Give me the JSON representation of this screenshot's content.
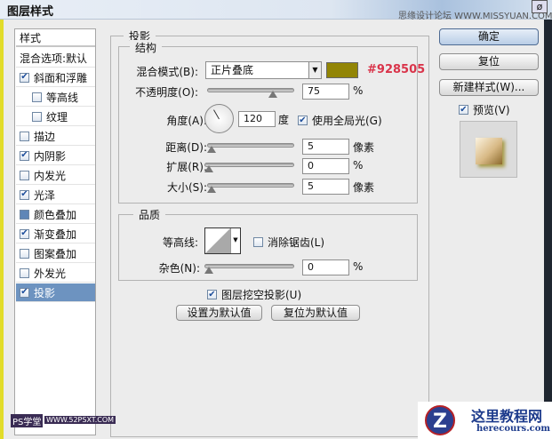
{
  "window": {
    "title": "图层样式",
    "close_label": "ø",
    "watermark": "思缘设计论坛 WWW.MISSYUAN.COM"
  },
  "styles": {
    "header": "样式",
    "blend_default": "混合选项:默认",
    "items": [
      {
        "label": "斜面和浮雕",
        "checked": true,
        "indent": false
      },
      {
        "label": "等高线",
        "checked": false,
        "indent": true
      },
      {
        "label": "纹理",
        "checked": false,
        "indent": true
      },
      {
        "label": "描边",
        "checked": false,
        "indent": false
      },
      {
        "label": "内阴影",
        "checked": true,
        "indent": false
      },
      {
        "label": "内发光",
        "checked": false,
        "indent": false
      },
      {
        "label": "光泽",
        "checked": true,
        "indent": false
      },
      {
        "label": "颜色叠加",
        "checked": false,
        "indent": false,
        "filled": true
      },
      {
        "label": "渐变叠加",
        "checked": true,
        "indent": false
      },
      {
        "label": "图案叠加",
        "checked": false,
        "indent": false
      },
      {
        "label": "外发光",
        "checked": false,
        "indent": false
      },
      {
        "label": "投影",
        "checked": true,
        "indent": false,
        "selected": true
      }
    ]
  },
  "panel": {
    "title": "投影",
    "structure": {
      "title": "结构",
      "blend_mode_label": "混合模式(B):",
      "blend_mode": "正片叠底",
      "color": "#928505",
      "color_text": "#928505",
      "opacity_label": "不透明度(O):",
      "opacity": "75",
      "opacity_unit": "%",
      "angle_label": "角度(A):",
      "angle": "120",
      "angle_unit": "度",
      "global_light_label": "使用全局光(G)",
      "global_light": true,
      "distance_label": "距离(D):",
      "distance": "5",
      "distance_unit": "像素",
      "spread_label": "扩展(R):",
      "spread": "0",
      "spread_unit": "%",
      "size_label": "大小(S):",
      "size": "5",
      "size_unit": "像素"
    },
    "quality": {
      "title": "品质",
      "contour_label": "等高线:",
      "antialias_label": "消除锯齿(L)",
      "antialias": false,
      "noise_label": "杂色(N):",
      "noise": "0",
      "noise_unit": "%"
    },
    "knockout_label": "图层挖空投影(U)",
    "knockout": true,
    "make_default": "设置为默认值",
    "reset_default": "复位为默认值"
  },
  "buttons": {
    "ok": "确定",
    "reset": "复位",
    "new_style": "新建样式(W)...",
    "preview_label": "预览(V)",
    "preview": true
  },
  "watermarks": {
    "ps": "PS学堂",
    "ps_url": "WWW.52PSXT.COM",
    "site": "这里教程网",
    "site_url": "herecours.com"
  }
}
